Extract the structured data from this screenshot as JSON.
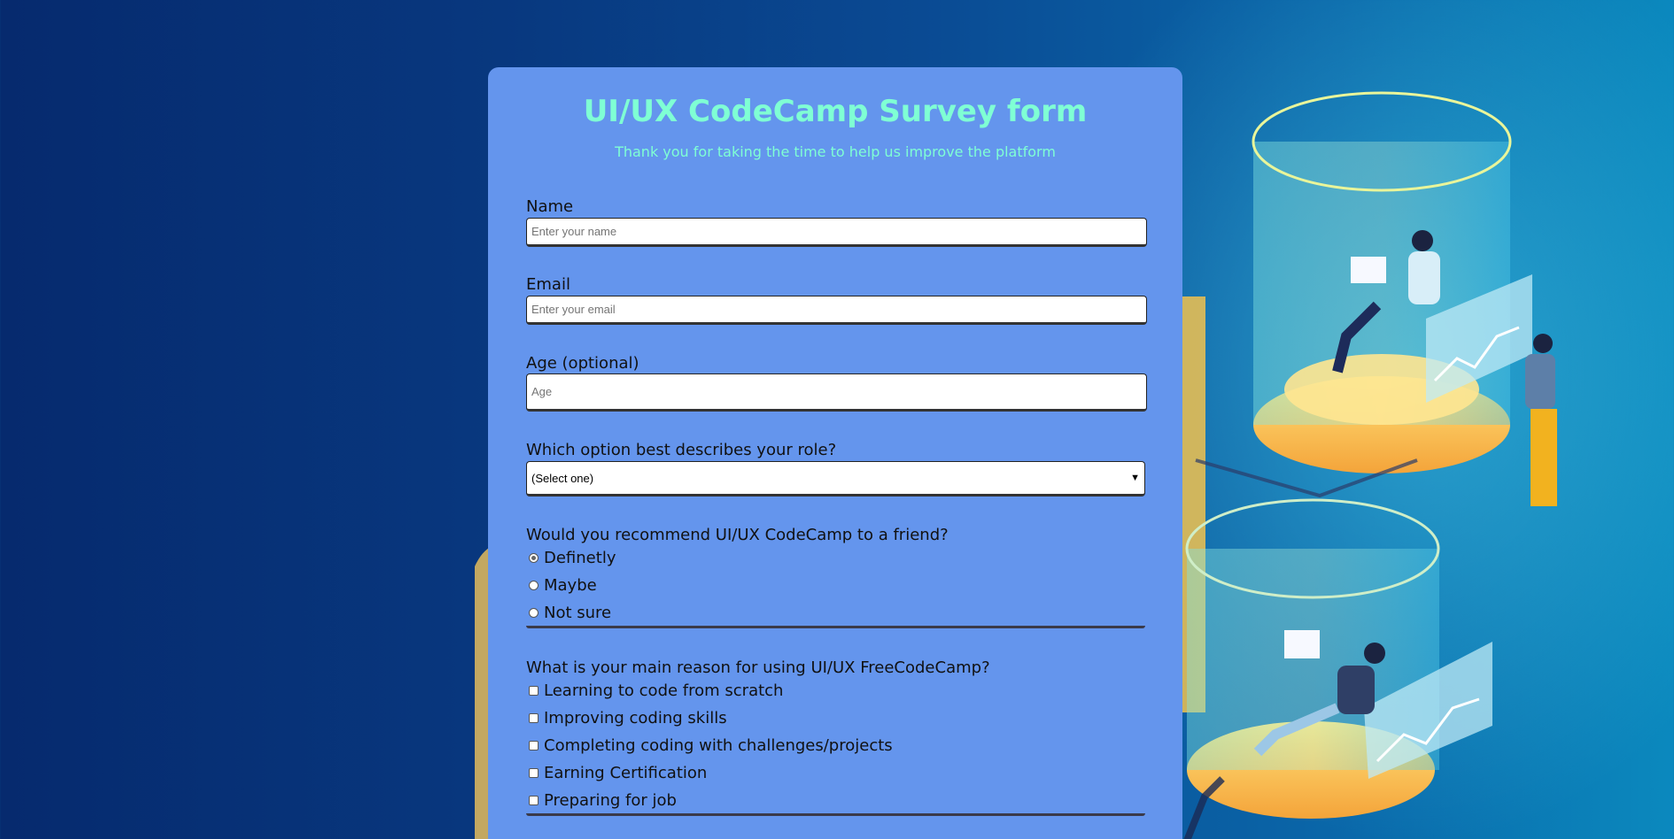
{
  "form": {
    "title": "UI/UX CodeCamp Survey form",
    "subtitle": "Thank you for taking the time to help us improve the platform",
    "name_label": "Name",
    "name_placeholder": "Enter your name",
    "email_label": "Email",
    "email_placeholder": "Enter your email",
    "age_label": "Age (optional)",
    "age_placeholder": "Age",
    "role_label": "Which option best describes your role?",
    "role_selected": "(Select one)",
    "recommend_label": "Would you recommend UI/UX CodeCamp to a friend?",
    "recommend_options": [
      "Definetly",
      "Maybe",
      "Not sure"
    ],
    "recommend_selected": "Definetly",
    "reason_label": "What is your main reason for using UI/UX FreeCodeCamp?",
    "reason_options": [
      "Learning to code from scratch",
      "Improving coding skills",
      "Completing coding with challenges/projects",
      "Earning Certification",
      "Preparing for job"
    ]
  },
  "colors": {
    "card_bg": "#6495ed",
    "heading": "#7fffd4",
    "background_start": "#062a6e",
    "background_end": "#0b89be"
  },
  "icons": {
    "select_arrow": "chevron-down-icon",
    "background_art": "isometric-data-center-illustration"
  }
}
